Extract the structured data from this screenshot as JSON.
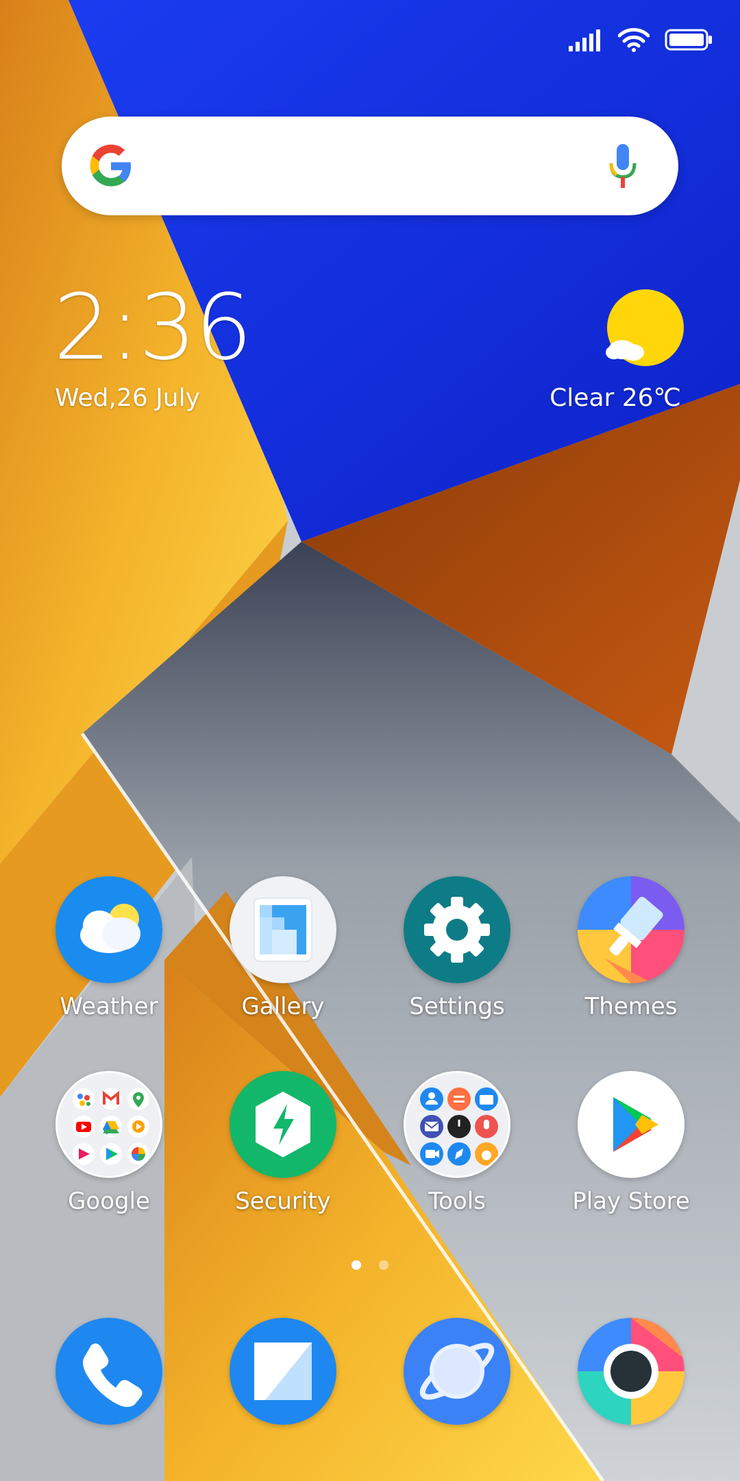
{
  "status_bar": {
    "signal_icon": "signal-icon",
    "wifi_icon": "wifi-icon",
    "battery_icon": "battery-icon"
  },
  "search": {
    "logo_icon": "google-g-icon",
    "mic_icon": "microphone-icon"
  },
  "clock": {
    "time": "2:36",
    "date": "Wed,26 July"
  },
  "weather_widget": {
    "icon": "sunny-partly-cloudy-icon",
    "summary": "Clear 26℃"
  },
  "apps": [
    {
      "label": "Weather",
      "icon": "weather-icon"
    },
    {
      "label": "Gallery",
      "icon": "gallery-icon"
    },
    {
      "label": "Settings",
      "icon": "settings-gear-icon"
    },
    {
      "label": "Themes",
      "icon": "themes-brush-icon"
    },
    {
      "label": "Google",
      "icon": "google-folder-icon"
    },
    {
      "label": "Security",
      "icon": "security-shield-icon"
    },
    {
      "label": "Tools",
      "icon": "tools-folder-icon"
    },
    {
      "label": "Play Store",
      "icon": "play-store-icon"
    }
  ],
  "pager": {
    "pages": 2,
    "active": 1
  },
  "dock": [
    {
      "icon": "phone-icon"
    },
    {
      "icon": "messages-icon"
    },
    {
      "icon": "browser-icon"
    },
    {
      "icon": "camera-icon"
    }
  ],
  "colors": {
    "accent_blue": "#1e88f0",
    "settings_teal": "#0e7c86",
    "security_green": "#12b76a"
  }
}
